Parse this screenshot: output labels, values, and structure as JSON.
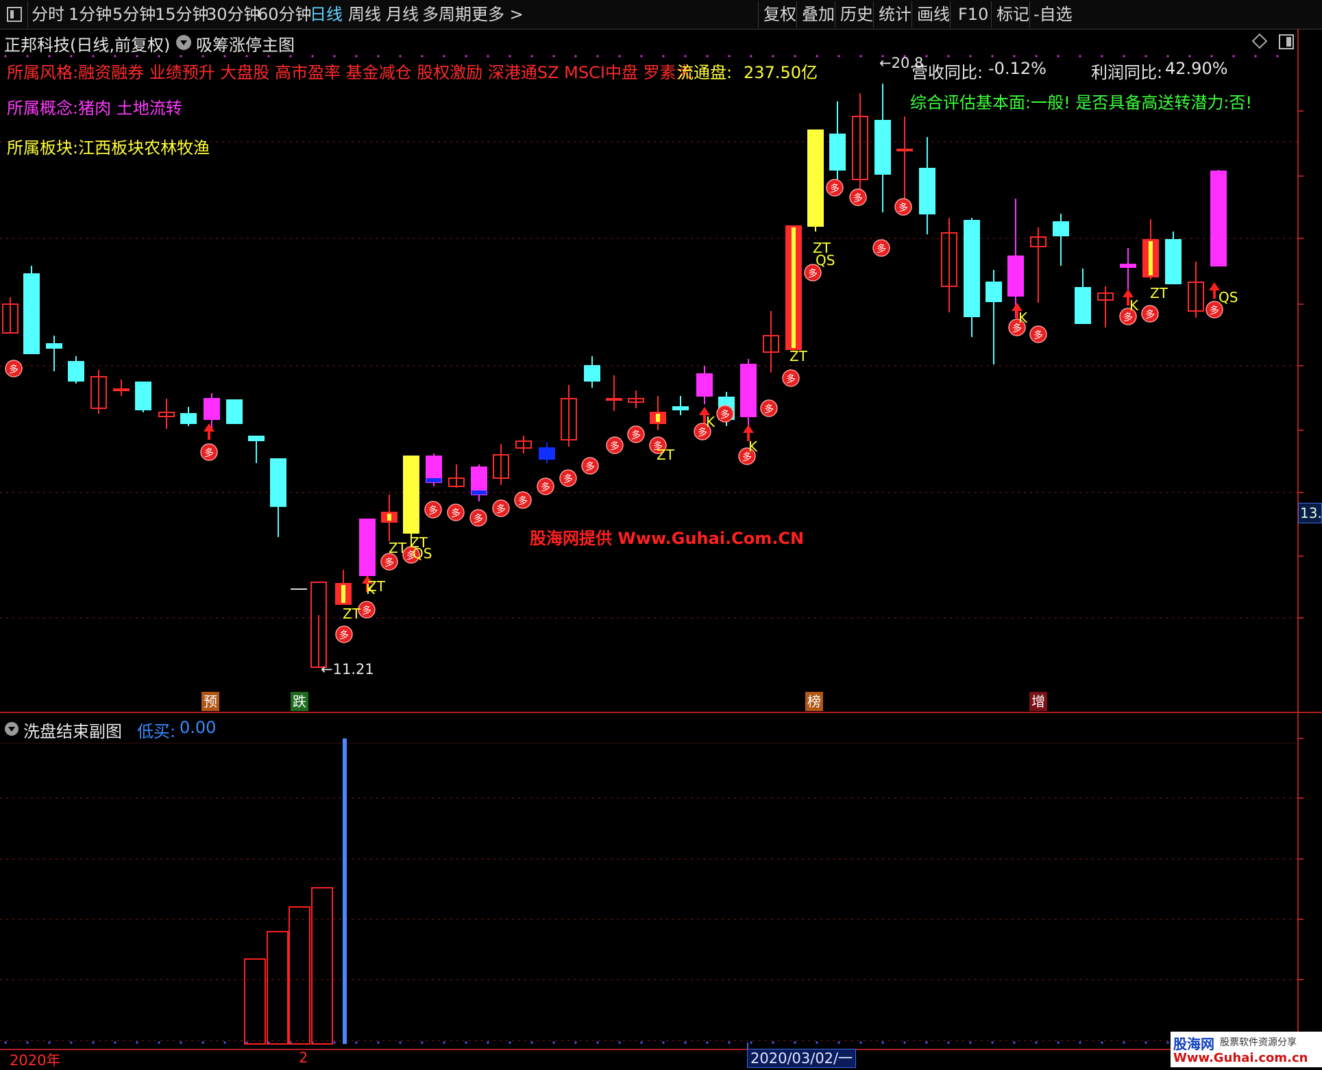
{
  "toolbar": {
    "periods": [
      "分时",
      "1分钟",
      "5分钟",
      "15分钟",
      "30分钟",
      "60分钟",
      "日线",
      "周线",
      "月线",
      "多周期",
      "更多 >"
    ],
    "active_period": "日线",
    "tools": [
      "复权",
      "叠加",
      "历史",
      "统计",
      "画线",
      "F10",
      "标记",
      "-自选"
    ]
  },
  "main_chart": {
    "stock_title": "正邦科技(日线,前复权)",
    "indicator_name": "吸筹涨停主图",
    "style_line": "所属风格:融资融券 业绩预升 大盘股 高市盈率 基金减仓 股权激励 深港通SZ MSCI中盘 罗素大",
    "float_label": "流通盘:",
    "float_value": "237.50亿",
    "revenue_label": "营收同比:",
    "revenue_value": "-0.12%",
    "profit_label": "利润同比:",
    "profit_value": "42.90%",
    "concept_line": "所属概念:猪肉 土地流转",
    "sector_line": "所属板块:江西板块农林牧渔",
    "assessment_line": "综合评估基本面:一般! 是否具备高送转潜力:否!",
    "watermark": "股海网提供 Www.Guhai.Com.CN",
    "high_marker": "20.8",
    "low_marker": "11.21",
    "price_tag": "13.",
    "event_tags": [
      "预",
      "跌",
      "榜",
      "增"
    ]
  },
  "sub_chart": {
    "title": "洗盘结束副图",
    "low_buy_label": "低买:",
    "low_buy_value": "0.00"
  },
  "time_axis": {
    "year_label": "2020年",
    "month_label": "2",
    "cursor_date": "2020/03/02/一"
  },
  "brand": {
    "logo_text": "股海网",
    "logo_tagline": "股票软件资源分享",
    "logo_url": "Www.Guhai.com.cn"
  },
  "colors": {
    "up": "#ff2b2b",
    "down": "#54ffff",
    "limit_up_fill": "#ffff3a",
    "signal_fill": "#ff30ff",
    "grid": "#8a1a1a",
    "bg": "#000000"
  }
}
